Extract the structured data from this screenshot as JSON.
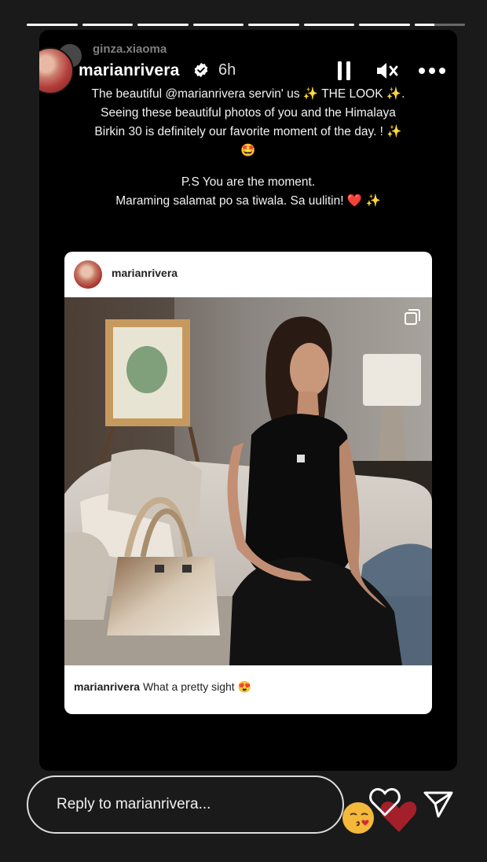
{
  "story": {
    "progress_segments": 8,
    "reposted_from": "ginza.xiaoma",
    "username": "marianrivera",
    "time_ago": "6h",
    "caption": {
      "line1": "The beautiful @marianrivera servin' us ✨ THE LOOK ✨.",
      "line2": "Seeing these beautiful photos of you and the Himalaya",
      "line3": "Birkin 30 is definitely our favorite moment of the day. ! ✨",
      "line4": "🤩",
      "line5": "P.S You are the moment.",
      "line6": "Maraming salamat po sa tiwala. Sa uulitin! ❤️ ✨"
    }
  },
  "shared_post": {
    "username": "marianrivera",
    "caption_user": "marianrivera",
    "caption_text": "What a pretty sight 😍"
  },
  "reply": {
    "placeholder": "Reply to marianrivera..."
  },
  "icons": {
    "pause": "pause-icon",
    "mute": "mute-icon",
    "more": "more-icon",
    "heart": "heart-icon",
    "send": "send-icon",
    "multi": "carousel-icon"
  },
  "colors": {
    "background": "#000000",
    "text": "#ffffff",
    "heart": "#d62839"
  }
}
